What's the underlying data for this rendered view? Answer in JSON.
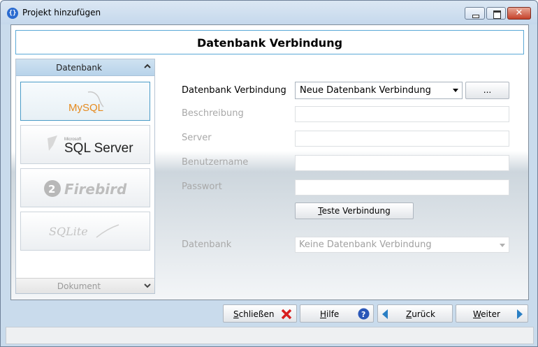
{
  "window": {
    "title": "Projekt hinzufügen",
    "icon": "app-icon",
    "controls": [
      "minimize-icon",
      "maximize-icon",
      "close-icon"
    ]
  },
  "header": {
    "title": "Datenbank Verbindung"
  },
  "sidebar": {
    "section_label": "Datenbank",
    "footer_label": "Dokument",
    "items": [
      {
        "label": "MySQL",
        "selected": true
      },
      {
        "label": "SQL Server",
        "sublabel": "Microsoft",
        "selected": false
      },
      {
        "label": "Firebird",
        "selected": false
      },
      {
        "label": "SQLite",
        "selected": false
      }
    ]
  },
  "form": {
    "connection": {
      "label": "Datenbank Verbindung",
      "value": "Neue Datenbank Verbindung",
      "more_label": "..."
    },
    "description": {
      "label": "Beschreibung",
      "value": ""
    },
    "server": {
      "label": "Server",
      "value": ""
    },
    "username": {
      "label": "Benutzername",
      "value": ""
    },
    "password": {
      "label": "Passwort",
      "value": ""
    },
    "test_button": {
      "accel": "T",
      "rest": "este Verbindung"
    },
    "database": {
      "label": "Datenbank",
      "value": "Keine Datenbank Verbindung"
    }
  },
  "footer": {
    "close": {
      "accel": "S",
      "rest": "chließen"
    },
    "help": {
      "accel": "H",
      "rest": "ilfe"
    },
    "back": {
      "accel": "Z",
      "rest": "urück"
    },
    "next": {
      "accel": "W",
      "rest": "eiter"
    }
  },
  "colors": {
    "accent": "#4a9bc7",
    "close_red": "#d81e1e",
    "help_blue": "#2a57b8",
    "arrow_blue": "#2a7fc4"
  }
}
